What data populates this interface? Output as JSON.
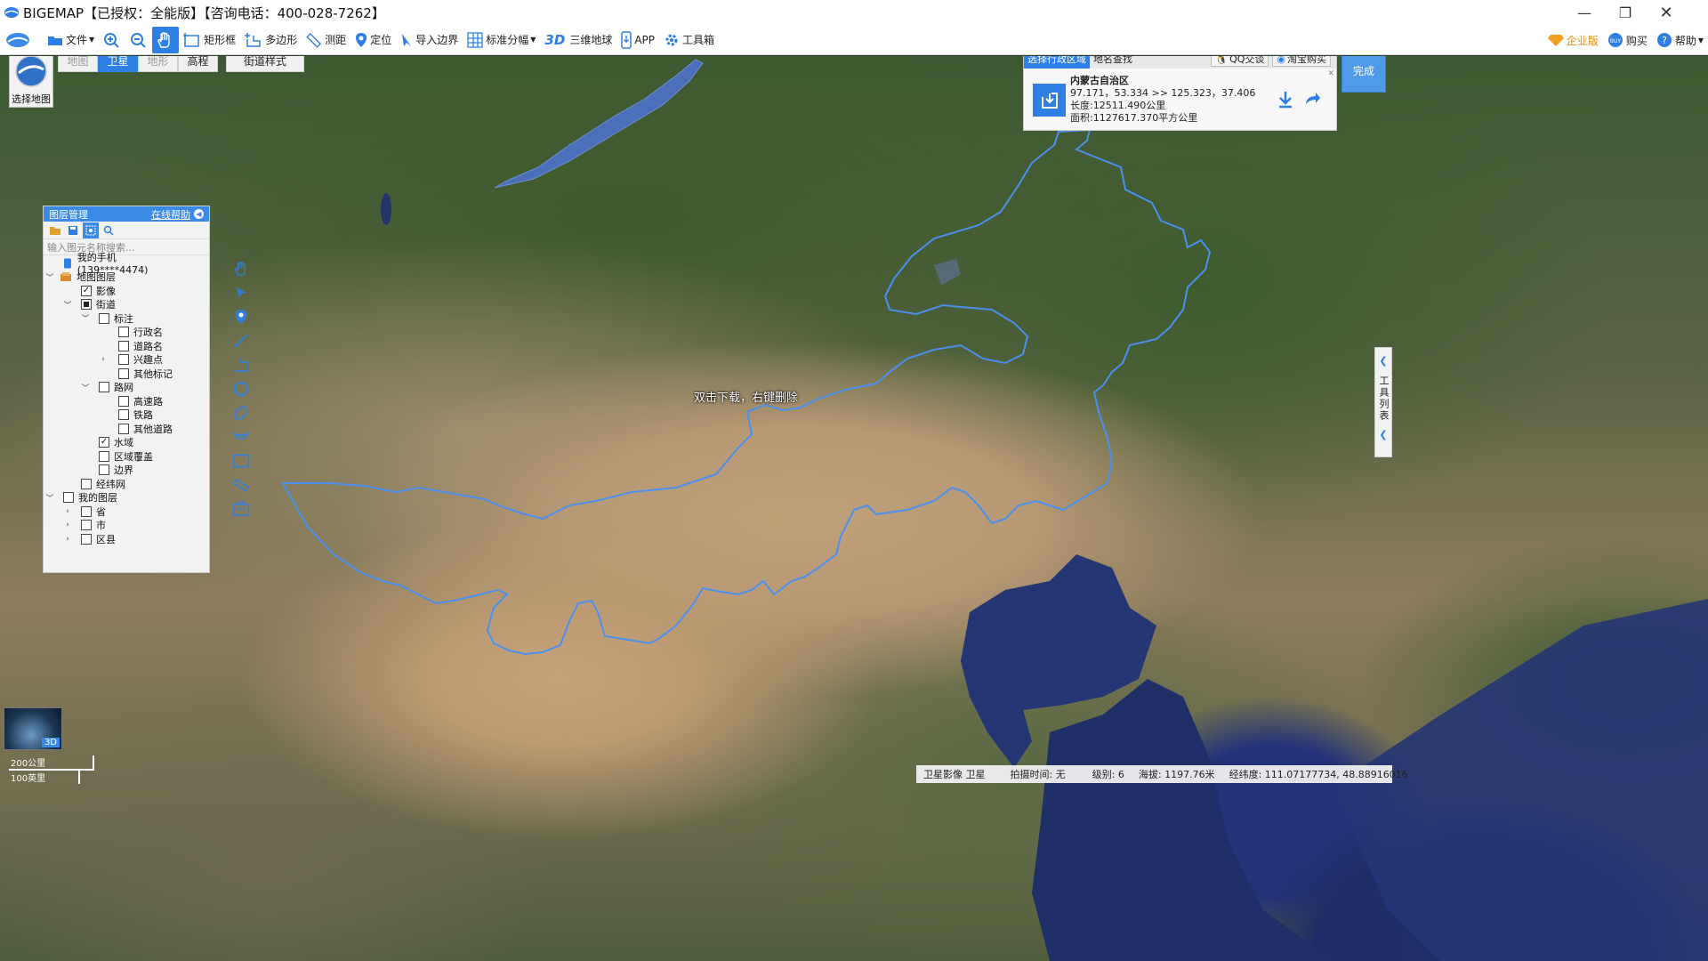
{
  "window": {
    "title": "BIGEMAP【已授权：全能版】【咨询电话：400-028-7262】",
    "controls": [
      "minimize",
      "restore",
      "close"
    ]
  },
  "toolbar": {
    "items": [
      {
        "label": "文件",
        "icon": "folder-icon"
      },
      {
        "label": "",
        "icon": "zoom-in-icon"
      },
      {
        "label": "",
        "icon": "zoom-out-icon"
      },
      {
        "label": "",
        "icon": "hand-pan-icon",
        "active": true
      },
      {
        "label": "矩形框",
        "icon": "rectangle-select-icon"
      },
      {
        "label": "多边形",
        "icon": "polygon-select-icon"
      },
      {
        "label": "测距",
        "icon": "ruler-icon"
      },
      {
        "label": "定位",
        "icon": "location-pin-icon"
      },
      {
        "label": "导入边界",
        "icon": "import-boundary-icon"
      },
      {
        "label": "标准分幅",
        "icon": "grid-icon"
      },
      {
        "label": "三维地球",
        "icon": "3d-text-icon",
        "prefix": "3D"
      },
      {
        "label": "APP",
        "icon": "phone-icon"
      },
      {
        "label": "工具箱",
        "icon": "gear-icon"
      }
    ],
    "right": [
      {
        "label": "企业版",
        "icon": "diamond-icon"
      },
      {
        "label": "购买",
        "icon": "buy-icon"
      },
      {
        "label": "帮助",
        "icon": "question-icon"
      }
    ]
  },
  "map_type": {
    "label": "选择地图",
    "tabs": [
      "地图",
      "卫星",
      "地形",
      "高程"
    ],
    "selected": "卫星",
    "style_button": "街道样式"
  },
  "layer_panel": {
    "title": "图层管理",
    "help": "在线帮助",
    "search_placeholder": "输入图元名称搜索...",
    "tree": [
      {
        "label": "我的手机(139****4474)",
        "level": 0,
        "icon": "phone-icon"
      },
      {
        "label": "地图图层",
        "level": 0,
        "expanded": true,
        "icon": "layers-icon"
      },
      {
        "label": "影像",
        "level": 1,
        "checked": "checked"
      },
      {
        "label": "街道",
        "level": 1,
        "checked": "partial",
        "expanded": true
      },
      {
        "label": "标注",
        "level": 2,
        "checked": "none",
        "expanded": true
      },
      {
        "label": "行政名",
        "level": 3,
        "checked": "none"
      },
      {
        "label": "道路名",
        "level": 3,
        "checked": "none"
      },
      {
        "label": "兴趣点",
        "level": 3,
        "checked": "none",
        "collapsed": true
      },
      {
        "label": "其他标记",
        "level": 3,
        "checked": "none"
      },
      {
        "label": "路网",
        "level": 2,
        "checked": "none",
        "expanded": true
      },
      {
        "label": "高速路",
        "level": 3,
        "checked": "none"
      },
      {
        "label": "铁路",
        "level": 3,
        "checked": "none"
      },
      {
        "label": "其他道路",
        "level": 3,
        "checked": "none"
      },
      {
        "label": "水域",
        "level": 2,
        "checked": "checked"
      },
      {
        "label": "区域覆盖",
        "level": 2,
        "checked": "none"
      },
      {
        "label": "边界",
        "level": 2,
        "checked": "none"
      },
      {
        "label": "经纬网",
        "level": 1,
        "checked": "none"
      },
      {
        "label": "我的图层",
        "level": 0,
        "checked": "none",
        "expanded": true
      },
      {
        "label": "省",
        "level": 1,
        "checked": "none",
        "collapsed": true
      },
      {
        "label": "市",
        "level": 1,
        "checked": "none",
        "collapsed": true
      },
      {
        "label": "区县",
        "level": 1,
        "checked": "none",
        "collapsed": true
      }
    ]
  },
  "draw_tools": [
    "hand-icon",
    "pointer-icon",
    "marker-icon",
    "line-icon",
    "polyline-icon",
    "circle-icon",
    "ellipse-icon",
    "arc-icon",
    "rectangle-icon",
    "measure-icon",
    "note-icon"
  ],
  "region_panel": {
    "tabs": [
      "选择行政区域",
      "地名查找"
    ],
    "selected_tab": "选择行政区域",
    "qq_button": "QQ交谈",
    "taobao_button": "淘宝购买",
    "region_name": "内蒙古自治区",
    "bounds": "97.171，53.334 >> 125.323，37.406",
    "length": "长度:12511.490公里",
    "area": "面积:1127617.370平方公里"
  },
  "done_button": "完成",
  "side_tab": {
    "label": "工具列表"
  },
  "map_hint": "双击下载，右键删除",
  "scale": {
    "km": "200公里",
    "mi": "100英里"
  },
  "globe_label": "3D",
  "status_bar": {
    "source": "卫星影像 卫星",
    "capture_time": "拍摄时间: 无",
    "level": "级别:  6",
    "altitude": "海拔: 1197.76米",
    "coords": "经纬度:  111.07177734, 48.88916016"
  },
  "colors": {
    "accent": "#2e7fe3",
    "boundary": "#4a90ee",
    "panel_head": "#3b8ae6"
  }
}
